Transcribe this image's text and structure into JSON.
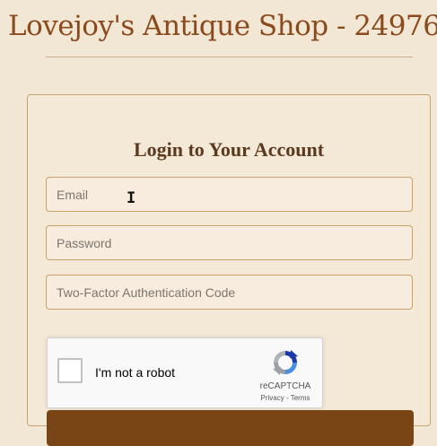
{
  "header": {
    "site_title": "Lovejoy's Antique Shop - 24976"
  },
  "login": {
    "heading": "Login to Your Account",
    "email": {
      "value": "",
      "placeholder": "Email"
    },
    "password": {
      "value": "",
      "placeholder": "Password"
    },
    "two_factor": {
      "value": "",
      "placeholder": "Two-Factor Authentication Code"
    },
    "submit_label": ""
  },
  "recaptcha": {
    "checkbox_label": "I'm not a robot",
    "checked": false,
    "brand": "reCAPTCHA",
    "privacy_link": "Privacy",
    "separator": " - ",
    "terms_link": "Terms",
    "icon": "recaptcha-logo-icon"
  },
  "cursor": {
    "icon": "text-cursor-icon"
  },
  "colors": {
    "page_background": "#f2e6d4",
    "title": "#8a4a1c",
    "heading": "#5b3a1e",
    "field_border": "#caa06b",
    "submit_button": "#7a4514"
  }
}
